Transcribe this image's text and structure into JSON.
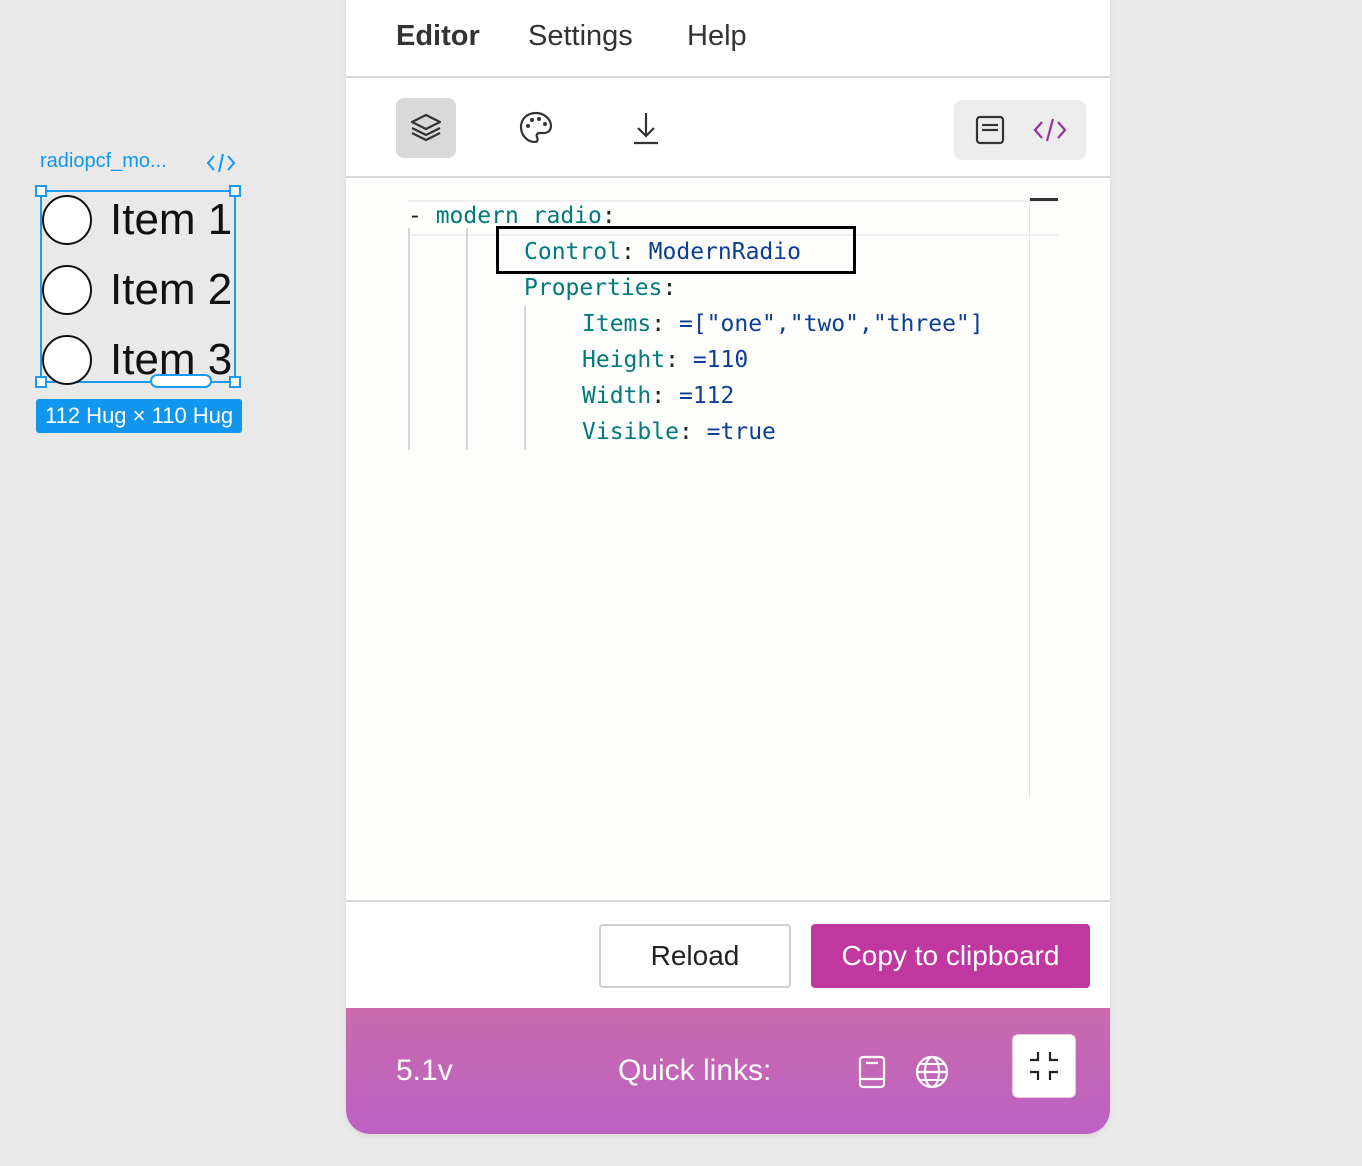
{
  "canvas": {
    "frame_name": "radiopcf_mo...",
    "frame_code_icon": "code-icon",
    "radio_items": [
      "Item 1",
      "Item 2",
      "Item 3"
    ],
    "size_badge": "112 Hug × 110 Hug"
  },
  "menu": {
    "editor": "Editor",
    "settings": "Settings",
    "help": "Help"
  },
  "toolbar": {
    "icons": [
      "layers-icon",
      "palette-icon",
      "download-icon"
    ],
    "view_toggle": [
      "document-icon",
      "code-icon"
    ]
  },
  "code": {
    "dash": "- ",
    "name": "modern_radio",
    "colon": ":",
    "control_key": "Control",
    "control_value": "ModernRadio",
    "properties_key": "Properties",
    "items_key": "Items",
    "items_value": "=[\"one\",\"two\",\"three\"]",
    "height_key": "Height",
    "height_value": "=110",
    "width_key": "Width",
    "width_value": "=112",
    "visible_key": "Visible",
    "visible_value": "=true"
  },
  "buttons": {
    "reload": "Reload",
    "copy": "Copy to clipboard"
  },
  "footer": {
    "version": "5.1v",
    "quick_links": "Quick links:",
    "icons": [
      "book-icon",
      "globe-icon",
      "collapse-icon"
    ]
  },
  "colors": {
    "accent": "#c0379f",
    "selection": "#1196ef",
    "code_key": "#007a7a",
    "code_value": "#0b3e94",
    "footer_gradient": [
      "#ca6aac",
      "#bd61c4"
    ]
  }
}
